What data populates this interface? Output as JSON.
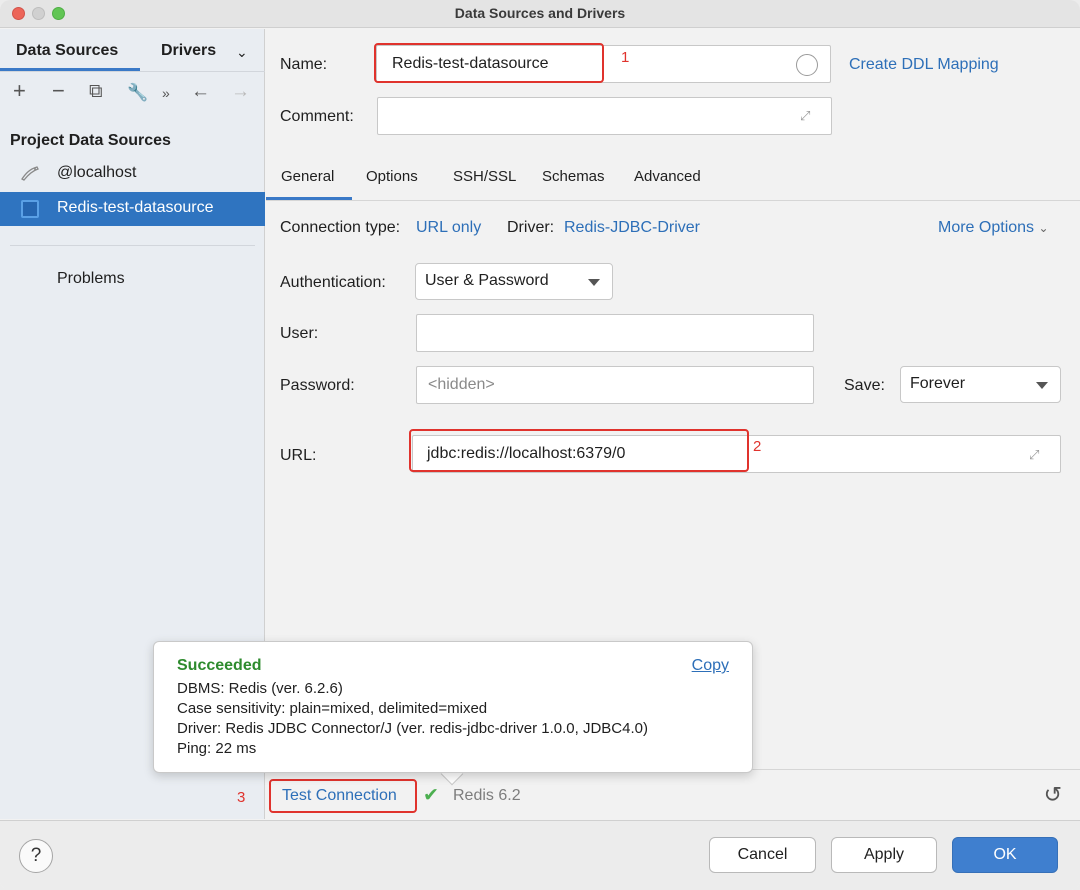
{
  "window": {
    "title": "Data Sources and Drivers"
  },
  "sidebar": {
    "tab_data_sources": "Data Sources",
    "tab_drivers": "Drivers",
    "toolbar": {
      "add": "+",
      "remove": "−",
      "copy": "⧉",
      "settings": "🔧",
      "more": "»",
      "back": "←",
      "forward": "→"
    },
    "heading": "Project Data Sources",
    "items": [
      {
        "label": "@localhost",
        "selected": false
      },
      {
        "label": "Redis-test-datasource",
        "selected": true
      }
    ],
    "problems": "Problems"
  },
  "form": {
    "name_label": "Name:",
    "name_value": "Redis-test-datasource",
    "create_ddl": "Create DDL Mapping",
    "comment_label": "Comment:",
    "comment_value": "",
    "tabs": [
      "General",
      "Options",
      "SSH/SSL",
      "Schemas",
      "Advanced"
    ],
    "active_tab": "General",
    "connection_type_label": "Connection type:",
    "connection_type_value": "URL only",
    "driver_label": "Driver:",
    "driver_value": "Redis-JDBC-Driver",
    "more_options": "More Options",
    "auth_label": "Authentication:",
    "auth_value": "User & Password",
    "user_label": "User:",
    "user_value": "",
    "password_label": "Password:",
    "password_placeholder": "<hidden>",
    "save_label": "Save:",
    "save_value": "Forever",
    "url_label": "URL:",
    "url_value": "jdbc:redis://localhost:6379/0"
  },
  "annotations": {
    "n1": "1",
    "n2": "2",
    "n3": "3",
    "color": "#e0332d"
  },
  "popup": {
    "status": "Succeeded",
    "copy": "Copy",
    "dbms": "DBMS: Redis (ver. 6.2.6)",
    "case": "Case sensitivity: plain=mixed, delimited=mixed",
    "driver": "Driver: Redis JDBC Connector/J (ver. redis-jdbc-driver 1.0.0, JDBC4.0)",
    "ping": "Ping: 22 ms"
  },
  "bottom": {
    "test_connection": "Test Connection",
    "status_icon": "check-icon",
    "redis_version": "Redis 6.2"
  },
  "footer": {
    "help": "?",
    "cancel": "Cancel",
    "apply": "Apply",
    "ok": "OK"
  },
  "colors": {
    "accent": "#3a79c7",
    "link": "#2d6fb8",
    "success": "#2e8b2e",
    "selection": "#2f74c0"
  }
}
